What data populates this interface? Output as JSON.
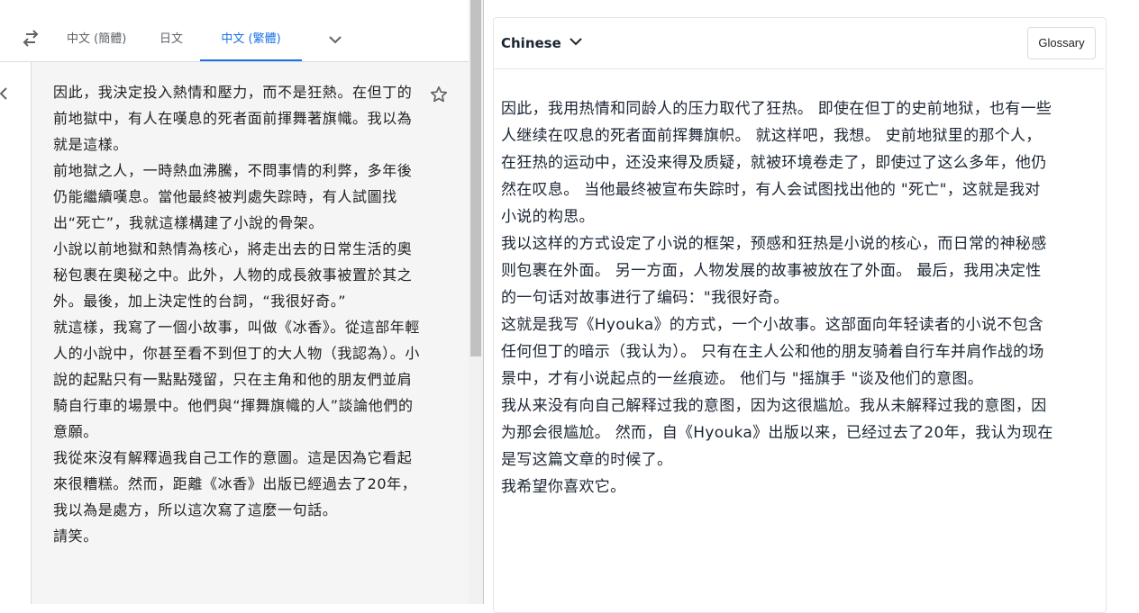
{
  "left": {
    "tabs": [
      "中文 (簡體)",
      "日文",
      "中文 (繁體)"
    ],
    "active_tab_index": 2,
    "accent_color": "#1a73e8",
    "icons": [
      "swap-languages-icon",
      "chevron-down-icon",
      "star-icon",
      "chevron-left-icon"
    ],
    "paragraphs": [
      "因此，我決定投入熱情和壓力，而不是狂熱。在但丁的前地獄中，有人在嘆息的死者面前揮舞著旗幟。我以為就是這樣。",
      "前地獄之人，一時熱血沸騰，不問事情的利弊，多年後仍能繼續嘆息。當他最終被判處失踪時，有人試圖找出“死亡”，我就這樣構建了小說的骨架。",
      "小說以前地獄和熱情為核心，將走出去的日常生活的奧秘包裹在奧秘之中。此外，人物的成長敘事被置於其之外。最後，加上決定性的台詞，“我很好奇。”",
      "就這樣，我寫了一個小故事，叫做《冰香》。從這部年輕人的小說中，你甚至看不到但丁的大人物（我認為）。小說的起點只有一點點殘留，只在主角和他的朋友們並肩騎自行車的場景中。他們與“揮舞旗幟的人”談論他們的意願。",
      "我從來沒有解釋過我自己工作的意圖。這是因為它看起來很糟糕。然而，距離《冰香》出版已經過去了20年，我以為是處方，所以這次寫了這麼一句話。",
      "請笑。"
    ]
  },
  "right": {
    "target_language": "Chinese",
    "glossary_label": "Glossary",
    "paragraphs": [
      "因此，我用热情和同龄人的压力取代了狂热。 即使在但丁的史前地狱，也有一些人继续在叹息的死者面前挥舞旗帜。 就这样吧，我想。 史前地狱里的那个人，在狂热的运动中，还没来得及质疑，就被环境卷走了，即使过了这么多年，他仍然在叹息。 当他最终被宣布失踪时，有人会试图找出他的 \"死亡\"，这就是我对小说的构思。",
      "我以这样的方式设定了小说的框架，预感和狂热是小说的核心，而日常的神秘感则包裹在外面。 另一方面，人物发展的故事被放在了外面。 最后，我用决定性的一句话对故事进行了编码：\"我很好奇。",
      "这就是我写《Hyouka》的方式，一个小故事。这部面向年轻读者的小说不包含任何但丁的暗示（我认为）。 只有在主人公和他的朋友骑着自行车并肩作战的场景中，才有小说起点的一丝痕迹。 他们与 \"摇旗手 \"谈及他们的意图。",
      "我从来没有向自己解释过我的意图，因为这很尴尬。我从未解释过我的意图，因为那会很尴尬。 然而，自《Hyouka》出版以来，已经过去了20年，我认为现在是写这篇文章的时候了。",
      "我希望你喜欢它。"
    ]
  }
}
